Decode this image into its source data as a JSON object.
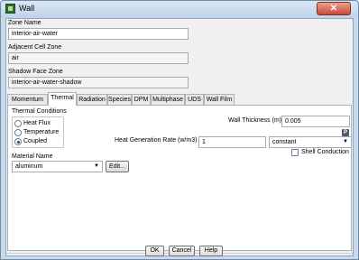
{
  "window": {
    "title": "Wall",
    "close_icon": "close-icon"
  },
  "zone_name": {
    "label": "Zone Name",
    "value": "interior-air-water"
  },
  "adjacent_cell_zone": {
    "label": "Adjacent Cell Zone",
    "value": "air"
  },
  "shadow_face_zone": {
    "label": "Shadow Face Zone",
    "value": "interior-air-water-shadow"
  },
  "tabs": [
    {
      "label": "Momentum",
      "active": false
    },
    {
      "label": "Thermal",
      "active": true
    },
    {
      "label": "Radiation",
      "active": false
    },
    {
      "label": "Species",
      "active": false
    },
    {
      "label": "DPM",
      "active": false
    },
    {
      "label": "Multiphase",
      "active": false
    },
    {
      "label": "UDS",
      "active": false
    },
    {
      "label": "Wall Film",
      "active": false
    }
  ],
  "thermal": {
    "conditions_label": "Thermal Conditions",
    "options": [
      {
        "label": "Heat Flux",
        "selected": false
      },
      {
        "label": "Temperature",
        "selected": false
      },
      {
        "label": "Coupled",
        "selected": true
      }
    ],
    "wall_thickness": {
      "label": "Wall Thickness (m)",
      "value": "0.005",
      "help": "P"
    },
    "heat_generation": {
      "label": "Heat Generation Rate (w/m3)",
      "value": "1",
      "method": "constant"
    },
    "material": {
      "label": "Material Name",
      "value": "aluminum",
      "edit_label": "Edit..."
    },
    "shell_conduction": {
      "label": "Shell Conduction",
      "checked": false
    }
  },
  "buttons": {
    "ok": "OK",
    "cancel": "Cancel",
    "help": "Help"
  }
}
